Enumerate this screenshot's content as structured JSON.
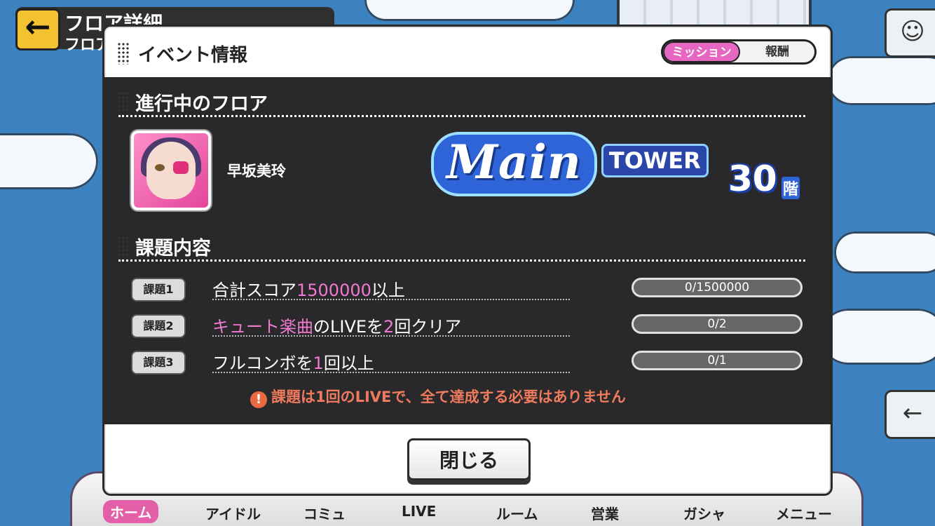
{
  "background": {
    "header_title": "フロア詳細",
    "header_sub": "フロア",
    "back_icon": "arrow-left-icon",
    "nav": [
      {
        "label": "ホーム"
      },
      {
        "label": "アイドル"
      },
      {
        "label": "コミュ"
      },
      {
        "label": "LIVE"
      },
      {
        "label": "ルーム"
      },
      {
        "label": "営業"
      },
      {
        "label": "ガシャ"
      },
      {
        "label": "メニュー"
      }
    ]
  },
  "dialog": {
    "title": "イベント情報",
    "tabs": {
      "mission": "ミッション",
      "reward": "報酬",
      "active": "mission"
    },
    "current_floor_heading": "進行中のフロア",
    "character_name": "早坂美玲",
    "logo": {
      "main": "Main",
      "sub": "TOWER"
    },
    "floor": {
      "number": "30",
      "unit": "階"
    },
    "tasks_heading": "課題内容",
    "tasks": [
      {
        "label": "課題1",
        "parts": [
          "合計スコア",
          "1500000",
          "以上"
        ],
        "progress": "0/1500000"
      },
      {
        "label": "課題2",
        "parts": [
          "キュート楽曲",
          "のLIVEを",
          "2",
          "回クリア"
        ],
        "progress": "0/2"
      },
      {
        "label": "課題3",
        "parts": [
          "フルコンボを",
          "1",
          "回以上"
        ],
        "progress": "0/1"
      }
    ],
    "notice": "課題は1回のLIVEで、全て達成する必要はありません",
    "close_label": "閉じる"
  },
  "colors": {
    "accent_pink": "#e667c2",
    "highlight": "#f07ad0",
    "notice": "#f07a5e"
  }
}
